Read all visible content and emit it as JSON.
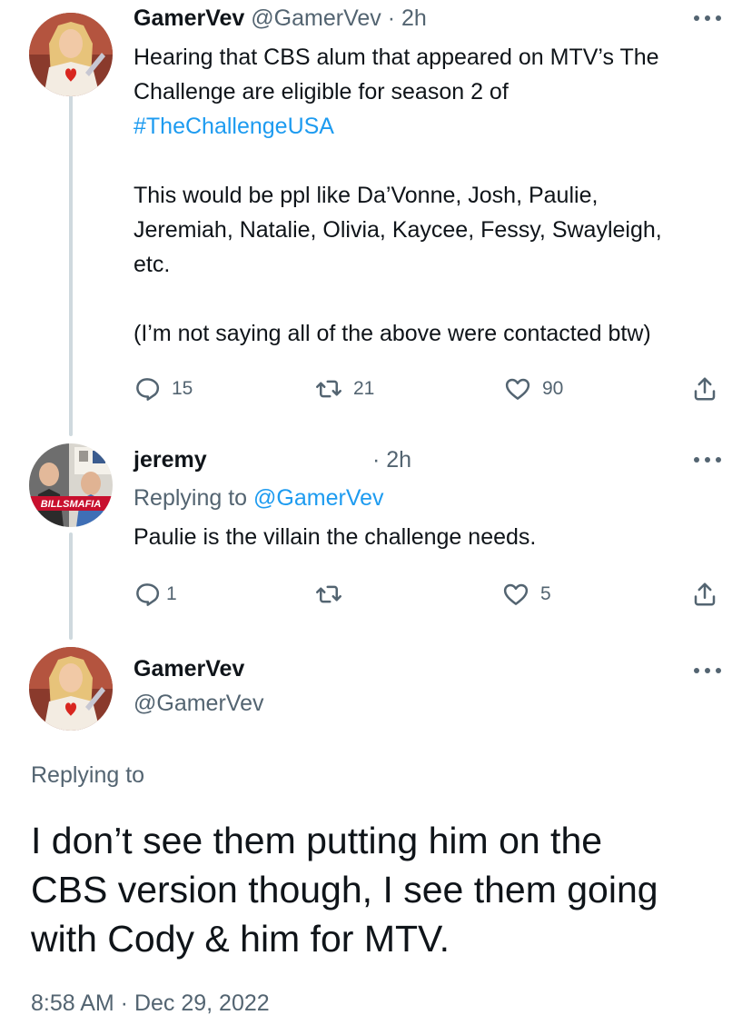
{
  "tweet1": {
    "display_name": "GamerVev",
    "handle": "@GamerVev",
    "time": "· 2h",
    "line1": "Hearing that CBS alum that appeared on MTV’s The",
    "line2": "Challenge are eligible for season 2 of",
    "hashtag": "#TheChallengeUSA",
    "para2_line1": "This would be ppl like Da’Vonne, Josh, Paulie,",
    "para2_line2": "Jeremiah, Natalie, Olivia, Kaycee, Fessy, Swayleigh,",
    "para2_line3": "etc.",
    "para3": "(I’m not saying all of the above were contacted btw)",
    "replies": "15",
    "retweets": "21",
    "likes": "90"
  },
  "tweet2": {
    "display_name": "jeremy",
    "time": "· 2h",
    "replying_prefix": "Replying to",
    "replying_handle": "@GamerVev",
    "text": "Paulie is the villain the challenge needs.",
    "replies": "1",
    "retweets": "",
    "likes": "5",
    "avatar_banner": "BILLSMAFIA"
  },
  "main_tweet": {
    "display_name": "GamerVev",
    "handle": "@GamerVev",
    "replying_label": "Replying to",
    "line1": "I don’t see them putting him on the",
    "line2": "CBS version though, I see them going",
    "line3": "with Cody & him for MTV.",
    "timestamp": "8:58 AM · Dec 29, 2022"
  },
  "icons": {
    "reply": "reply-icon",
    "retweet": "retweet-icon",
    "like": "heart-icon",
    "share": "share-icon",
    "more": "more-icon"
  },
  "colors": {
    "text": "#0f1419",
    "muted": "#536471",
    "link": "#1d9bf0",
    "thread_line": "#cfd9de"
  }
}
